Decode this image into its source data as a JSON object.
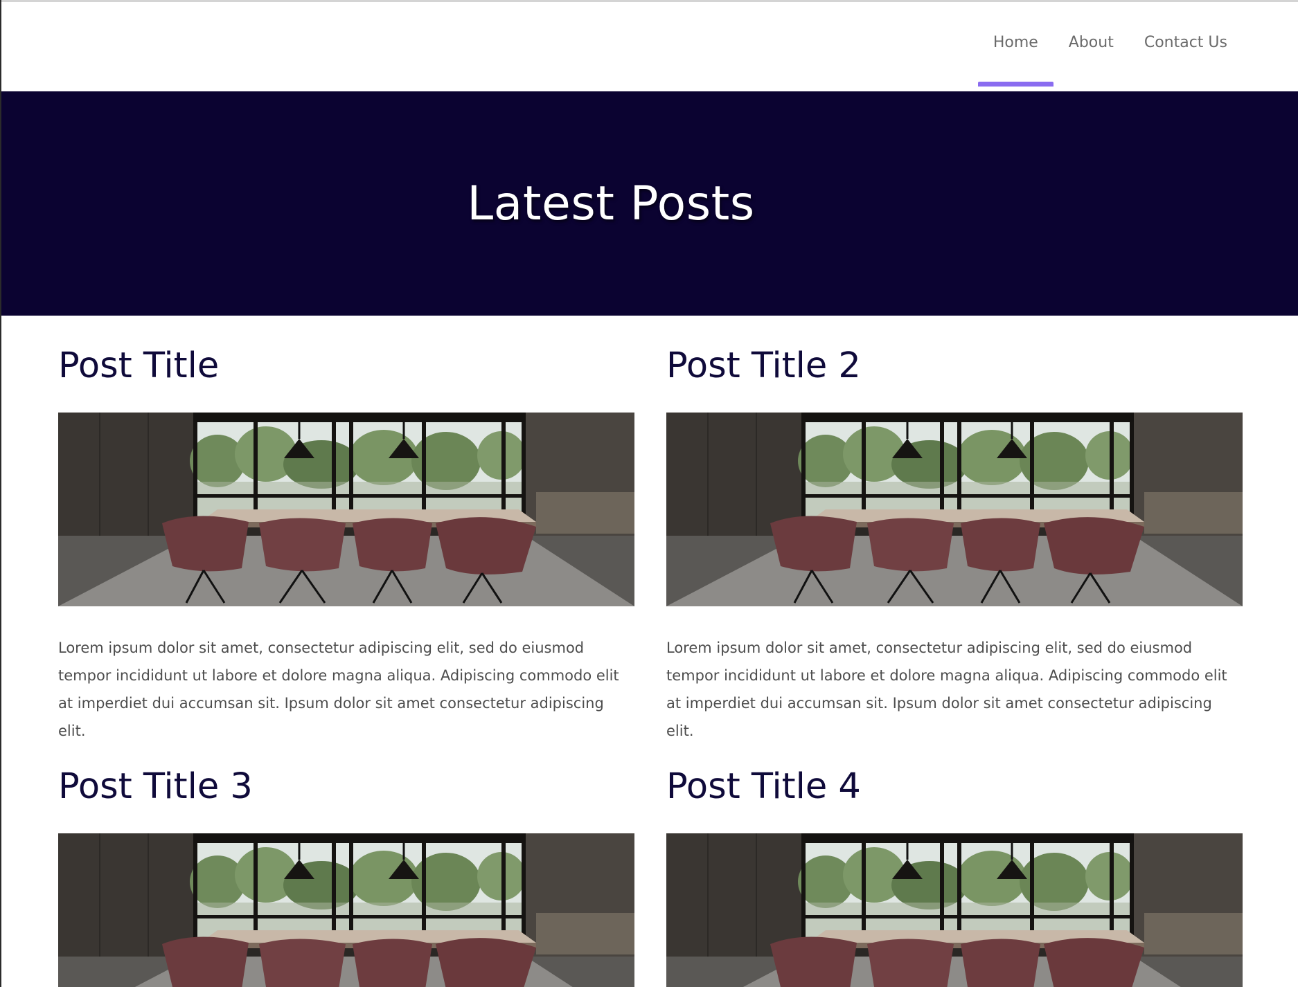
{
  "nav": {
    "items": [
      {
        "label": "Home",
        "active": true
      },
      {
        "label": "About",
        "active": false
      },
      {
        "label": "Contact Us",
        "active": false
      }
    ],
    "accent_color": "#8a6cf0"
  },
  "hero": {
    "title": "Latest Posts",
    "background_color": "#0b0331"
  },
  "posts": [
    {
      "title": "Post Title",
      "image": "meeting-room-photo",
      "excerpt": "Lorem ipsum dolor sit amet, consectetur adipiscing elit, sed do eiusmod tempor incididunt ut labore et dolore magna aliqua. Adipiscing commodo elit at imperdiet dui accumsan sit. Ipsum dolor sit amet consectetur adipiscing elit."
    },
    {
      "title": "Post Title 2",
      "image": "meeting-room-photo",
      "excerpt": "Lorem ipsum dolor sit amet, consectetur adipiscing elit, sed do eiusmod tempor incididunt ut labore et dolore magna aliqua. Adipiscing commodo elit at imperdiet dui accumsan sit. Ipsum dolor sit amet consectetur adipiscing elit."
    },
    {
      "title": "Post Title 3",
      "image": "meeting-room-photo",
      "excerpt": ""
    },
    {
      "title": "Post Title 4",
      "image": "meeting-room-photo",
      "excerpt": ""
    }
  ]
}
